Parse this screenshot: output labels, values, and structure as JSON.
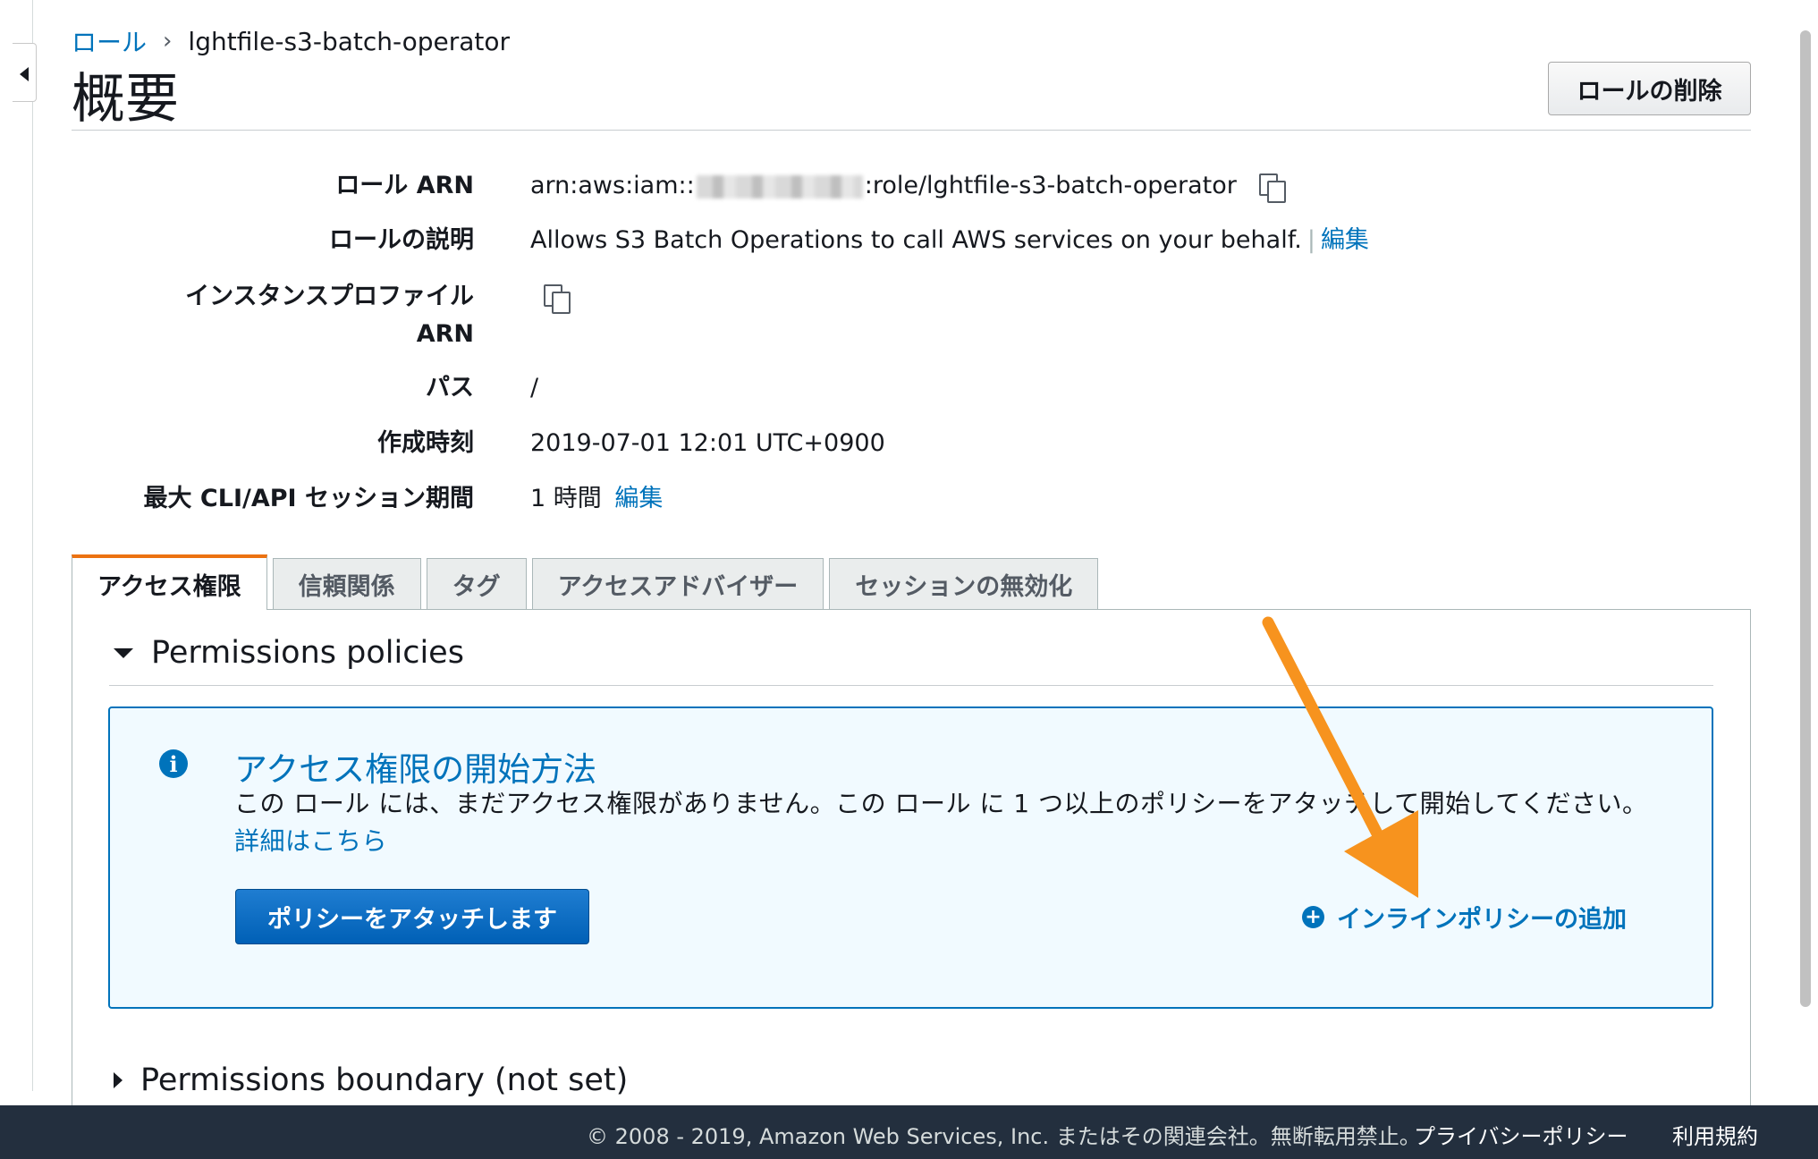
{
  "breadcrumb": {
    "parent": "ロール",
    "separator": "›",
    "current": "lghtfile-s3-batch-operator"
  },
  "header": {
    "title": "概要",
    "delete_button": "ロールの削除"
  },
  "summary": {
    "arn_label": "ロール ARN",
    "arn_prefix": "arn:aws:iam::",
    "arn_suffix": ":role/lghtfile-s3-batch-operator",
    "description_label": "ロールの説明",
    "description_value": "Allows S3 Batch Operations to call AWS services on your behalf.",
    "description_separator": "|",
    "description_edit": "編集",
    "instance_profile_label_line1": "インスタンスプロファイル",
    "instance_profile_label_line2": "ARN",
    "path_label": "パス",
    "path_value": "/",
    "created_label": "作成時刻",
    "created_value": "2019-07-01 12:01 UTC+0900",
    "session_label": "最大 CLI/API セッション期間",
    "session_value": "1 時間",
    "session_edit": "編集"
  },
  "tabs": [
    {
      "label": "アクセス権限",
      "active": true
    },
    {
      "label": "信頼関係",
      "active": false
    },
    {
      "label": "タグ",
      "active": false
    },
    {
      "label": "アクセスアドバイザー",
      "active": false
    },
    {
      "label": "セッションの無効化",
      "active": false
    }
  ],
  "permissions": {
    "section_title": "Permissions policies",
    "info_title": "アクセス権限の開始方法",
    "info_text": "この ロール には、まだアクセス権限がありません。この ロール に 1 つ以上のポリシーをアタッチして開始してください。",
    "info_link": "詳細はこちら",
    "attach_button": "ポリシーをアタッチします",
    "inline_add": "インラインポリシーの追加",
    "boundary_title": "Permissions boundary (not set)"
  },
  "footer": {
    "copyright": "© 2008 - 2019, Amazon Web Services, Inc. またはその関連会社。無断転用禁止。",
    "privacy": "プライバシーポリシー",
    "terms": "利用規約"
  },
  "colors": {
    "link": "#0073bb",
    "active_tab_accent": "#ec7211",
    "annotation_arrow": "#f7931e",
    "footer_bg": "#232f3e"
  },
  "icons": [
    "collapse-icon",
    "copy-icon",
    "info-icon",
    "plus-circle-icon",
    "caret-down-icon",
    "caret-right-icon"
  ]
}
